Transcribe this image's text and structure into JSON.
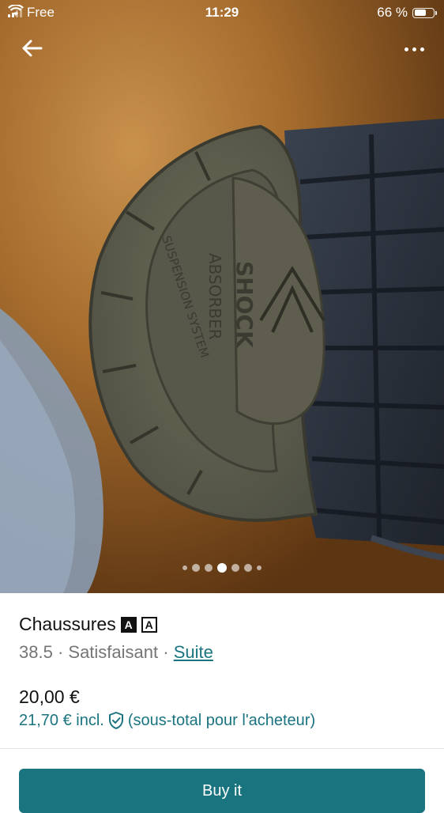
{
  "status_bar": {
    "carrier": "Free",
    "time": "11:29",
    "battery_percent": "66 %",
    "battery_level": 0.66
  },
  "gallery": {
    "page_count": 7,
    "active_index": 3,
    "sole_text_1": "SHOCK",
    "sole_text_2": "ABSORBER",
    "sole_text_3": "SUSPENSION SYSTEM"
  },
  "item": {
    "title": "Chaussures",
    "badge_1": "A",
    "badge_2": "A",
    "size": "38.5",
    "separator_1": " · ",
    "condition": "Satisfaisant",
    "separator_2": " · ",
    "more_link": "Suite",
    "price": "20,00 €",
    "price_incl": "21,70 € incl.",
    "buyer_note": "(sous-total pour l'acheteur)"
  },
  "actions": {
    "buy_label": "Buy it"
  },
  "icons": {
    "back": "arrow-left-icon",
    "more": "more-dots-icon",
    "shield": "shield-check-icon",
    "wifi": "wifi-icon",
    "battery": "battery-icon"
  },
  "colors": {
    "accent": "#1a7480",
    "secondary_text": "#757575"
  }
}
